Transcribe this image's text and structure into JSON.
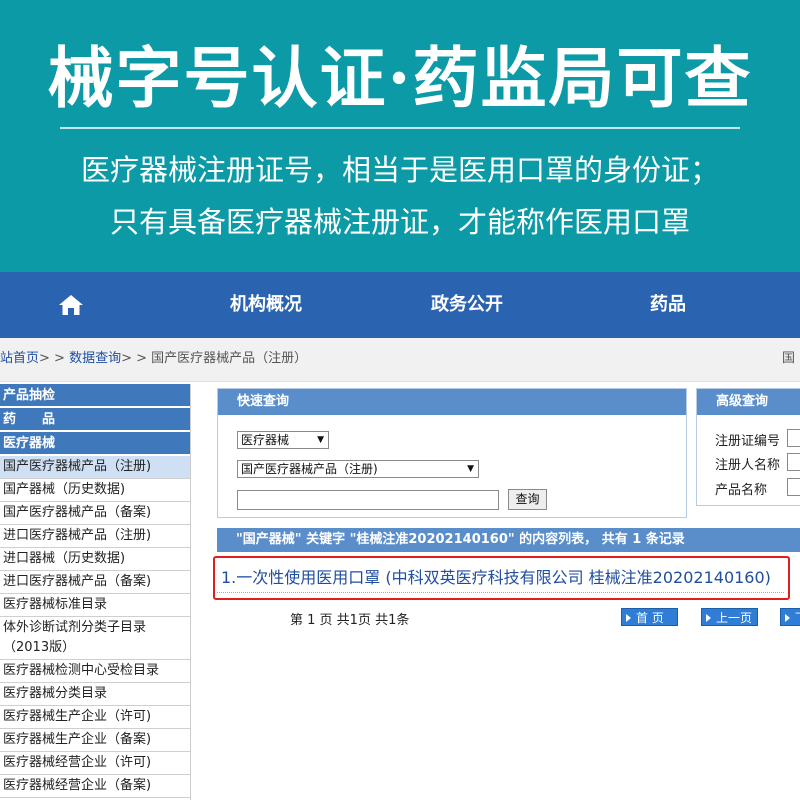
{
  "banner": {
    "title": "械字号认证·药监局可查",
    "subtitle_1": "医疗器械注册证号，相当于是医用口罩的身份证；",
    "subtitle_2": "只有具备医疗器械注册证，才能称作医用口罩"
  },
  "nav": {
    "home_icon": "home-icon",
    "items": [
      "机构概况",
      "政务公开",
      "药品"
    ]
  },
  "breadcrumb": {
    "items": [
      "站首页",
      "数据查询",
      "国产医疗器械产品（注册）"
    ],
    "separator": "> >",
    "right_text": "国"
  },
  "sidebar": {
    "cat_1": "产品抽检",
    "cat_2": "药　　品",
    "cat_3": "医疗器械",
    "items": [
      "国产医疗器械产品（注册)",
      "国产器械（历史数据)",
      "国产医疗器械产品（备案)",
      "进口医疗器械产品（注册)",
      "进口器械（历史数据)",
      "进口医疗器械产品（备案)",
      "医疗器械标准目录",
      "体外诊断试剂分类子目录（2013版）",
      "医疗器械检测中心受检目录",
      "医疗器械分类目录",
      "医疗器械生产企业（许可)",
      "医疗器械生产企业（备案)",
      "医疗器械经营企业（许可)",
      "医疗器械经营企业（备案)"
    ]
  },
  "quick_query": {
    "title": "快速查询",
    "select_1": "医疗器械",
    "select_2": "国产医疗器械产品（注册)",
    "search_value": "",
    "button": "查询"
  },
  "advanced_query": {
    "title": "高级查询",
    "fields": [
      "注册证编号",
      "注册人名称",
      "产品名称"
    ]
  },
  "results": {
    "header": "\"国产器械\" 关键字 \"桂械注准20202140160\" 的内容列表，  共有 1 条记录",
    "item": "1.一次性使用医用口罩 (中科双英医疗科技有限公司 桂械注准20202140160)",
    "page_info": "第 1 页 共1页 共1条",
    "first_page": "首 页",
    "prev_page": "上一页",
    "next_page": "下"
  },
  "colors": {
    "banner_bg": "#0b9aa6",
    "nav_bg": "#2a63b0",
    "panel_head": "#5a8ecb",
    "highlight_border": "#e01e1e",
    "link": "#1f4ea0"
  }
}
